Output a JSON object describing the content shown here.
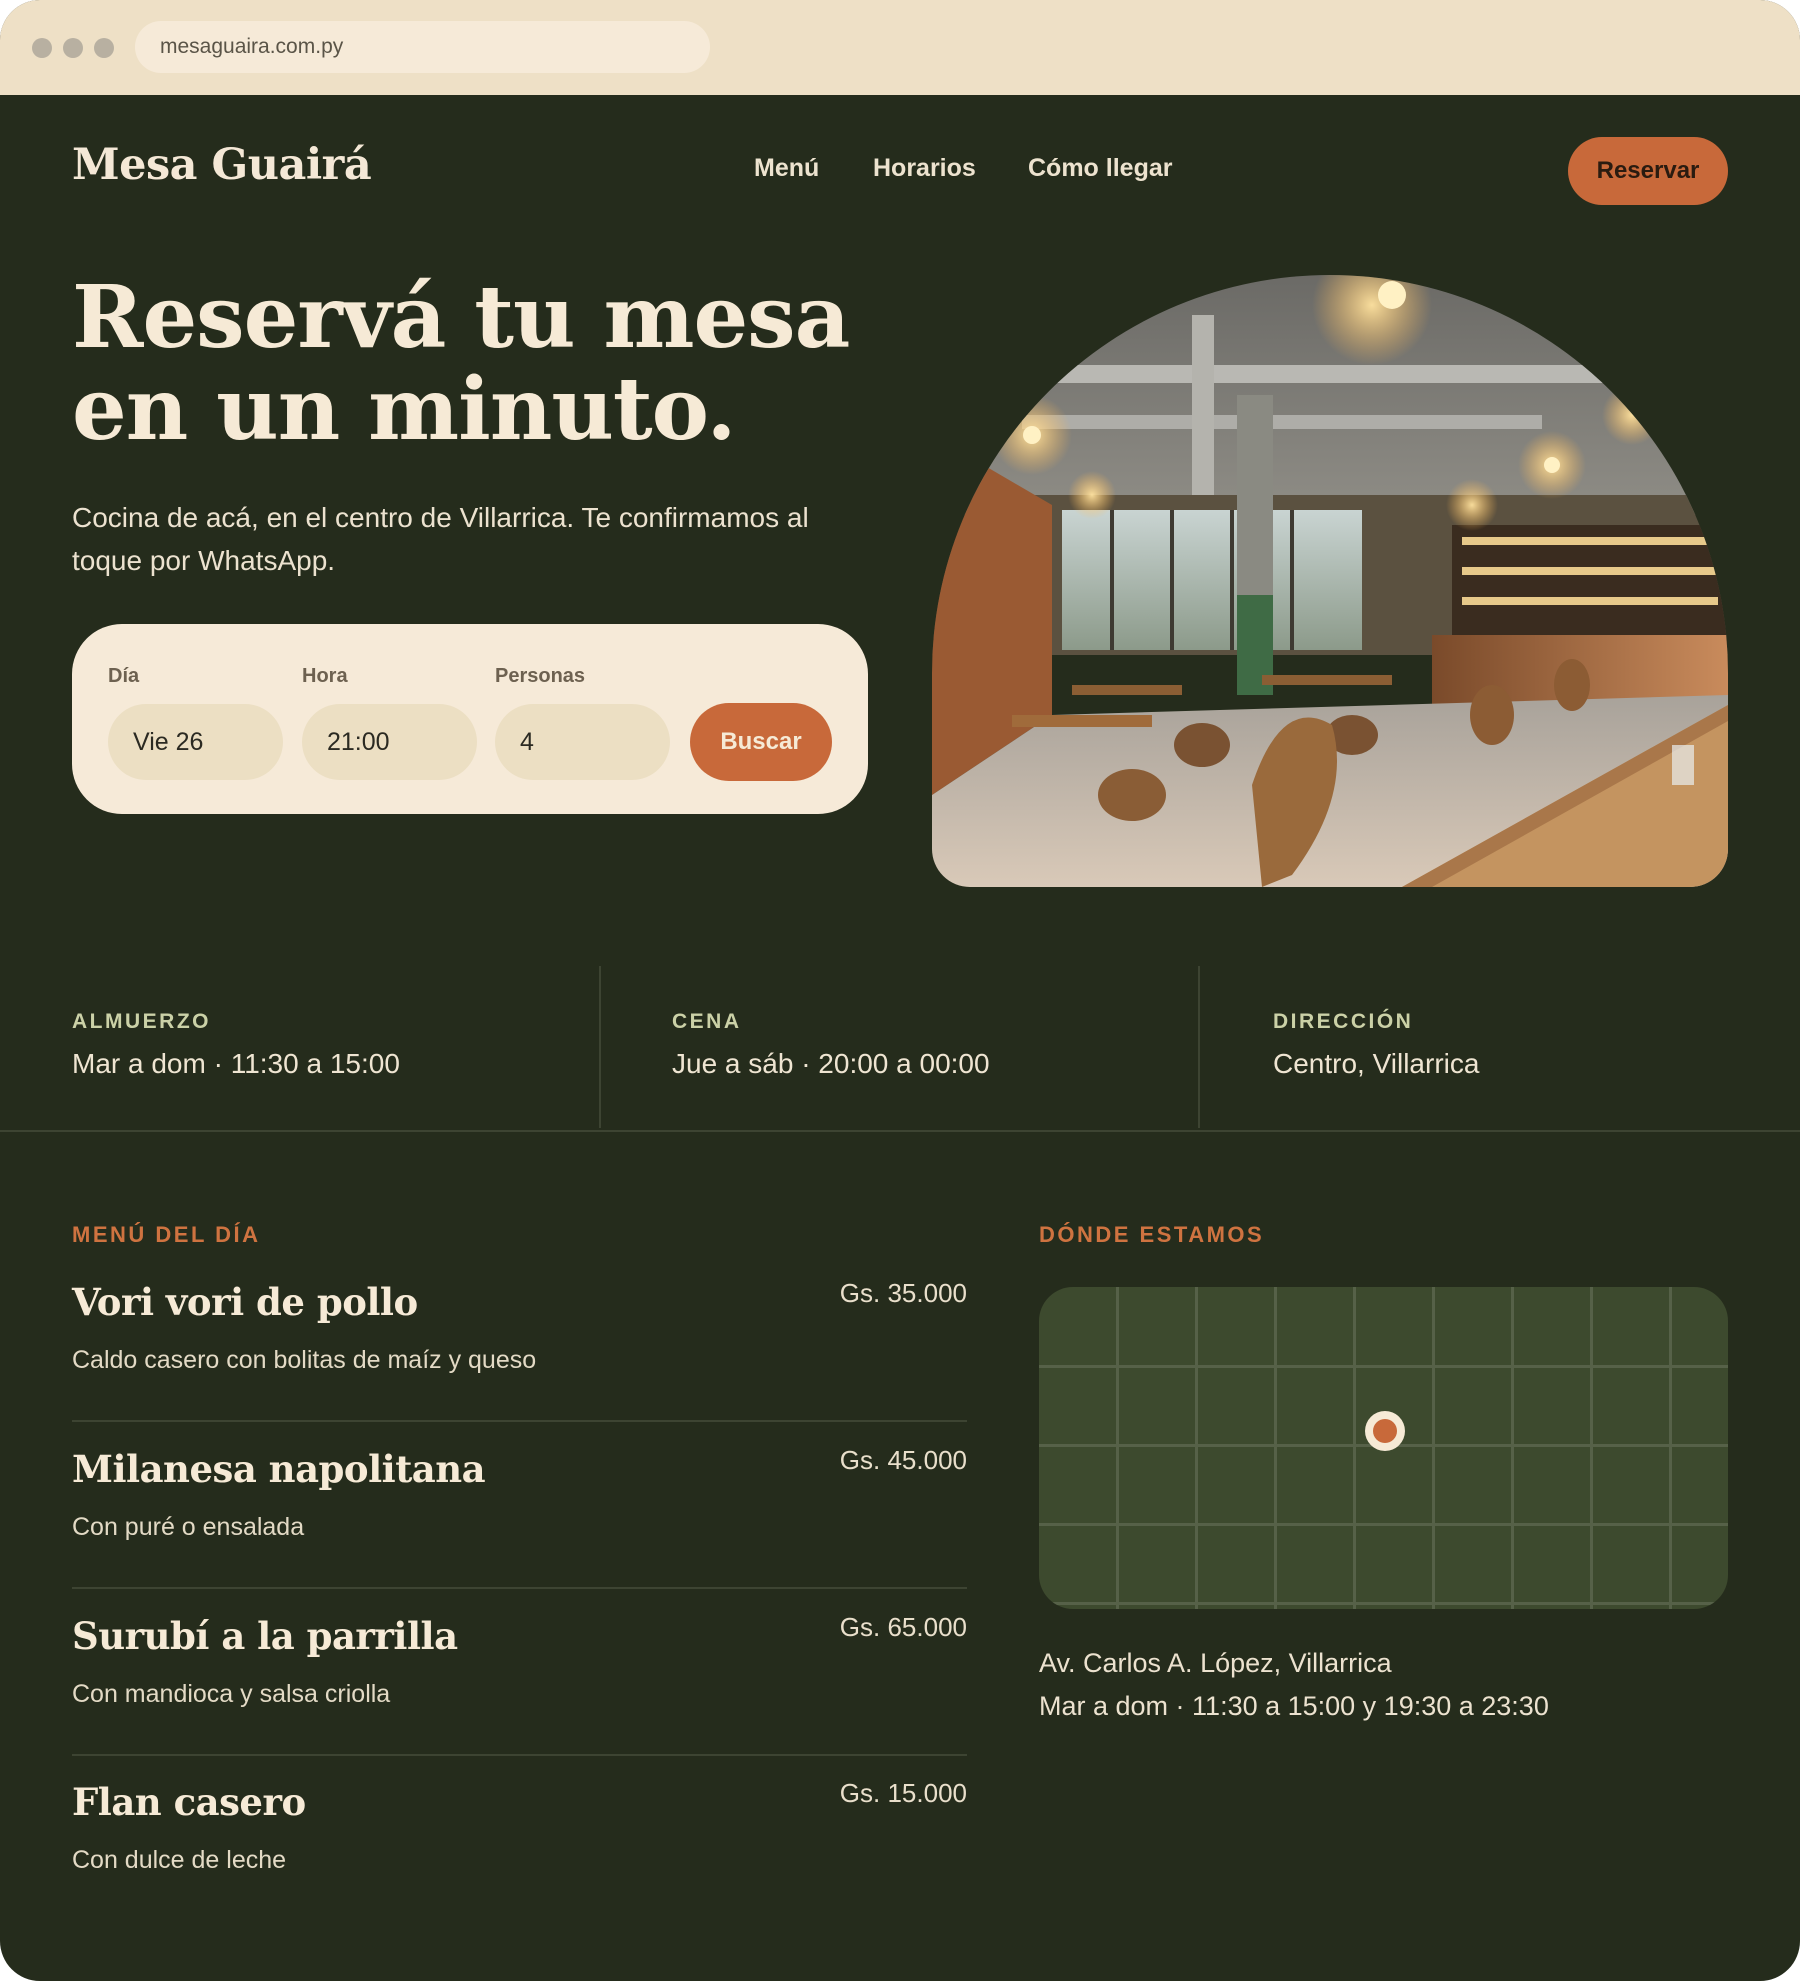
{
  "browser": {
    "url": "mesaguaira.com.py"
  },
  "nav": {
    "logo": "Mesa Guairá",
    "links": [
      "Menú",
      "Horarios",
      "Cómo llegar"
    ],
    "reserve_label": "Reservar"
  },
  "hero": {
    "title_line1": "Reservá tu mesa",
    "title_line2": "en un minuto.",
    "subtitle": "Cocina de acá, en el centro de Villarrica. Te confirmamos al toque por WhatsApp.",
    "image_icon": "restaurant-interior-photo"
  },
  "booking": {
    "fields": [
      {
        "label": "Día",
        "value": "Vie 26"
      },
      {
        "label": "Hora",
        "value": "21:00"
      },
      {
        "label": "Personas",
        "value": "4"
      }
    ],
    "search_label": "Buscar"
  },
  "info": [
    {
      "label": "ALMUERZO",
      "value": "Mar a dom · 11:30 a 15:00"
    },
    {
      "label": "CENA",
      "value": "Jue a sáb · 20:00 a 00:00"
    },
    {
      "label": "DIRECCIÓN",
      "value": "Centro, Villarrica"
    }
  ],
  "menu": {
    "heading": "MENÚ DEL DÍA",
    "items": [
      {
        "name": "Vori vori de pollo",
        "desc": "Caldo casero con bolitas de maíz y queso",
        "price": "Gs. 35.000"
      },
      {
        "name": "Milanesa napolitana",
        "desc": "Con puré o ensalada",
        "price": "Gs. 45.000"
      },
      {
        "name": "Surubí a la parrilla",
        "desc": "Con mandioca y salsa criolla",
        "price": "Gs. 65.000"
      },
      {
        "name": "Flan casero",
        "desc": "Con dulce de leche",
        "price": "Gs. 15.000"
      }
    ]
  },
  "location": {
    "heading": "DÓNDE ESTAMOS",
    "address": "Av. Carlos A. López, Villarrica",
    "hours": "Mar a dom · 11:30 a 15:00 y 19:30 a 23:30",
    "map_icon": "map-pin-icon"
  },
  "colors": {
    "background": "#252c1c",
    "accent": "#c8693a",
    "cream": "#f6ead8",
    "sage": "#cbd1a7"
  }
}
